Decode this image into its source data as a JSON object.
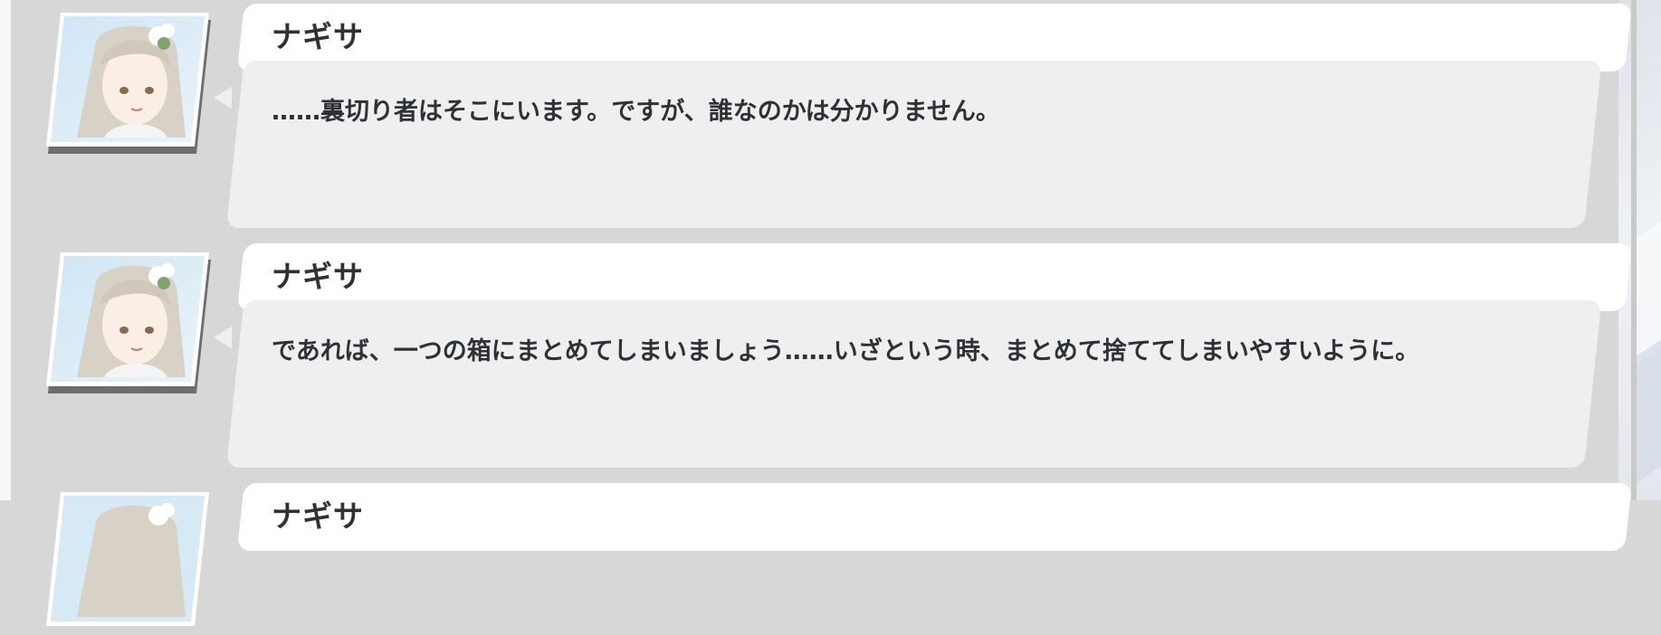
{
  "messages": [
    {
      "speaker": "ナギサ",
      "avatar_icon": "character-portrait-icon",
      "text": "……裏切り者はそこにいます。ですが、誰なのかは分かりません。"
    },
    {
      "speaker": "ナギサ",
      "avatar_icon": "character-portrait-icon",
      "text": "であれば、一つの箱にまとめてしまいましょう……いざという時、まとめて捨ててしまいやすいように。"
    },
    {
      "speaker": "ナギサ",
      "avatar_icon": "character-portrait-icon",
      "text": ""
    }
  ],
  "colors": {
    "background": "#d7d7d7",
    "name_bar": "#ffffff",
    "bubble": "#efefef",
    "text": "#2e3136"
  }
}
